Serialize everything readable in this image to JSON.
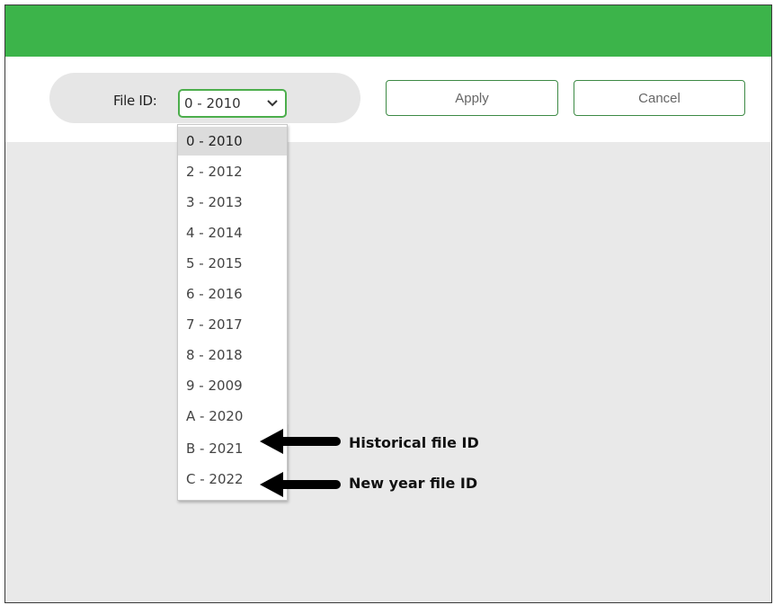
{
  "header": {
    "bar_color": "#3cb44a"
  },
  "filter": {
    "label": "File ID:",
    "selected_value": "0 - 2010"
  },
  "toolbar": {
    "apply_label": "Apply",
    "cancel_label": "Cancel"
  },
  "dropdown": {
    "options": [
      "0 - 2010",
      "2 - 2012",
      "3 - 2013",
      "4 - 2014",
      "5 - 2015",
      "6 - 2016",
      "7 - 2017",
      "8 - 2018",
      "9 - 2009",
      "A - 2020",
      "B - 2021",
      "C - 2022"
    ]
  },
  "annotations": {
    "historical": "Historical file ID",
    "new_year": "New year file ID"
  }
}
